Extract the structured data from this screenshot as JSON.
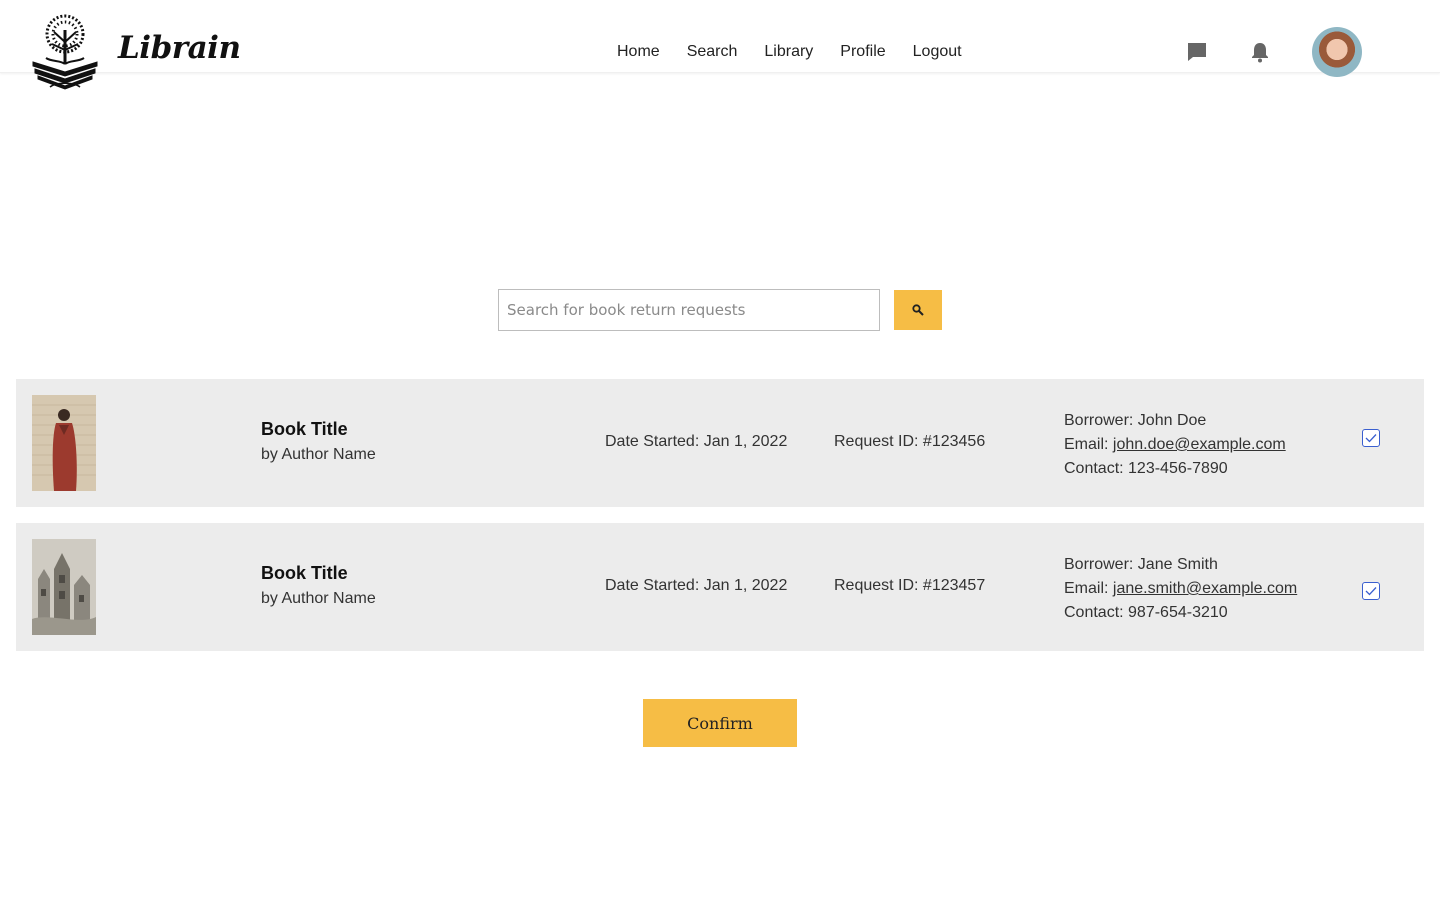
{
  "header": {
    "brand": "Librain",
    "nav": [
      "Home",
      "Search",
      "Library",
      "Profile",
      "Logout"
    ],
    "icons": [
      "chat-icon",
      "bell-icon"
    ]
  },
  "search": {
    "placeholder": "Search for book return requests",
    "value": "",
    "button_icon": "search-icon",
    "button_color": "#f6bd45"
  },
  "requests": [
    {
      "title": "Book Title",
      "author": "by Author Name",
      "date_started": "Date Started: Jan 1, 2022",
      "request_id": "Request ID: #123456",
      "borrower_label": "Borrower: John Doe",
      "email_label": "Email: ",
      "email": "john.doe@example.com",
      "contact": "Contact: 123-456-7890",
      "checked": true
    },
    {
      "title": "Book Title",
      "author": "by Author Name",
      "date_started": "Date Started: Jan 1, 2022",
      "request_id": "Request ID: #123457",
      "borrower_label": "Borrower: Jane Smith",
      "email_label": "Email: ",
      "email": "jane.smith@example.com",
      "contact": "Contact: 987-654-3210",
      "checked": true
    }
  ],
  "confirm_label": "Confirm",
  "colors": {
    "accent": "#f6bd45",
    "row_bg": "#ececec",
    "checkbox_border": "#3a5fcf"
  }
}
